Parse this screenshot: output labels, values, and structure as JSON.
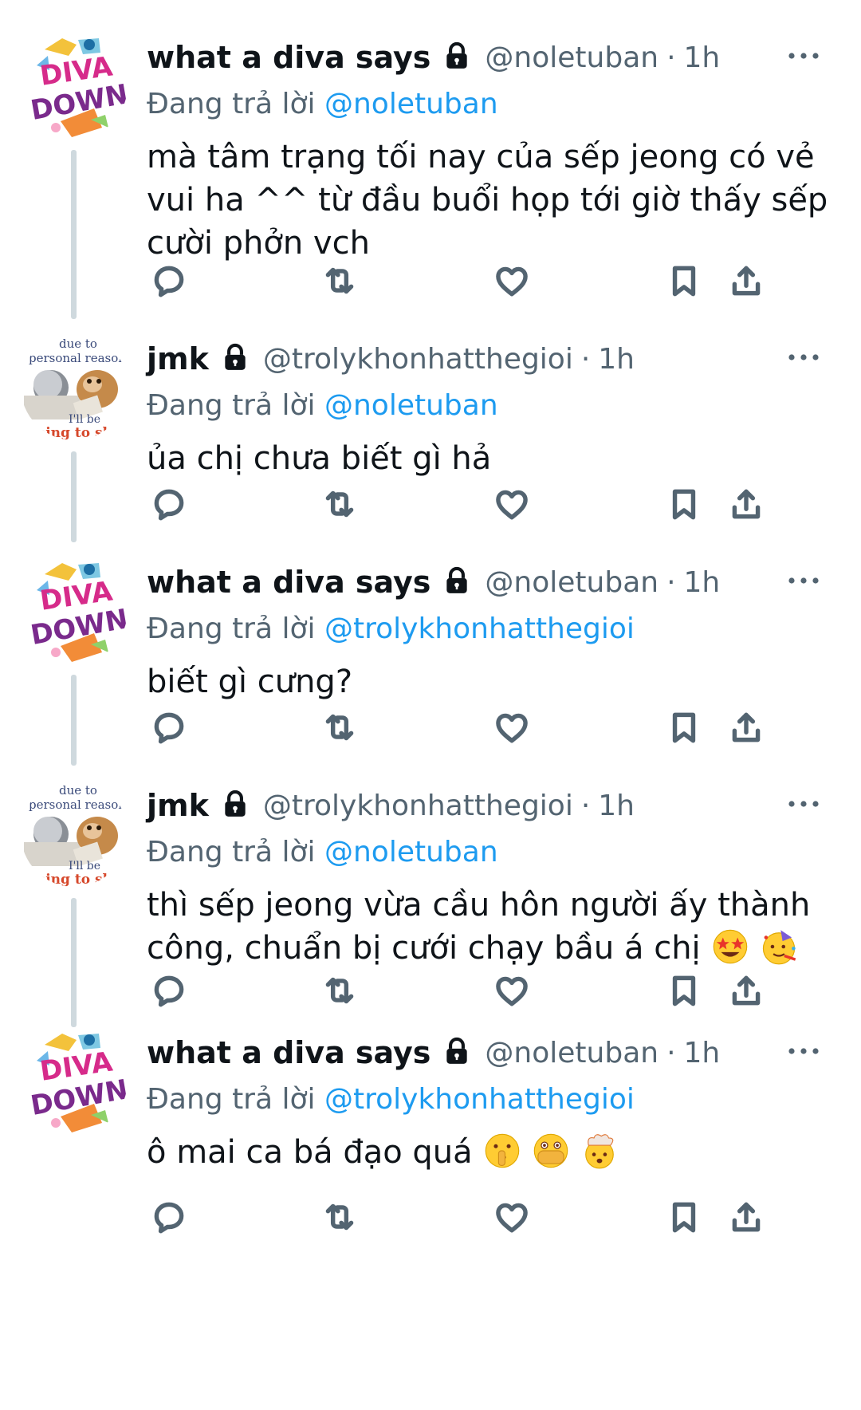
{
  "reply_prefix": "Đang trả lời",
  "tweets": [
    {
      "author": "what a diva says",
      "handle": "@noletuban",
      "separator": "·",
      "time": "1h",
      "reply_to": "@noletuban",
      "text": "mà tâm trạng tối nay của sếp jeong có vẻ vui ha ^^ từ đầu buổi họp tới giờ thấy sếp cười phởn vch",
      "avatar": "diva-down-avatar"
    },
    {
      "author": "jmk",
      "handle": "@trolykhonhatthegioi",
      "separator": "·",
      "time": "1h",
      "reply_to": "@noletuban",
      "text": "ủa chị chưa biết gì hả",
      "avatar": "personal-reason-avatar",
      "avatar_text": [
        "due to",
        "personal reason",
        "I'll be",
        "going to sleep"
      ]
    },
    {
      "author": "what a diva says",
      "handle": "@noletuban",
      "separator": "·",
      "time": "1h",
      "reply_to": "@trolykhonhatthegioi",
      "text": "biết gì cưng?",
      "avatar": "diva-down-avatar"
    },
    {
      "author": "jmk",
      "handle": "@trolykhonhatthegioi",
      "separator": "·",
      "time": "1h",
      "reply_to": "@noletuban",
      "text": "thì sếp jeong vừa cầu hôn người ấy thành công, chuẩn bị cưới chạy bầu á chị",
      "emojis": [
        "star-struck-emoji",
        "partying-face-emoji"
      ],
      "avatar": "personal-reason-avatar",
      "avatar_text": [
        "due to",
        "personal reason",
        "I'll be",
        "going to sleep"
      ]
    },
    {
      "author": "what a diva says",
      "handle": "@noletuban",
      "separator": "·",
      "time": "1h",
      "reply_to": "@trolykhonhatthegioi",
      "text": "ô mai ca bá đạo quá",
      "emojis": [
        "shushing-face-emoji",
        "face-with-open-eyes-and-hand-over-mouth-emoji",
        "exploding-head-emoji"
      ],
      "avatar": "diva-down-avatar"
    }
  ],
  "avatar_logo_text": [
    "DIVA",
    "DOWN!"
  ],
  "icons": [
    "reply-icon",
    "retweet-icon",
    "like-icon",
    "bookmark-icon",
    "share-icon",
    "lock-icon",
    "more-icon"
  ],
  "colors": {
    "text": "#0f1419",
    "secondary": "#536471",
    "link": "#1d9bf0",
    "thread_line": "#cfd9de"
  }
}
